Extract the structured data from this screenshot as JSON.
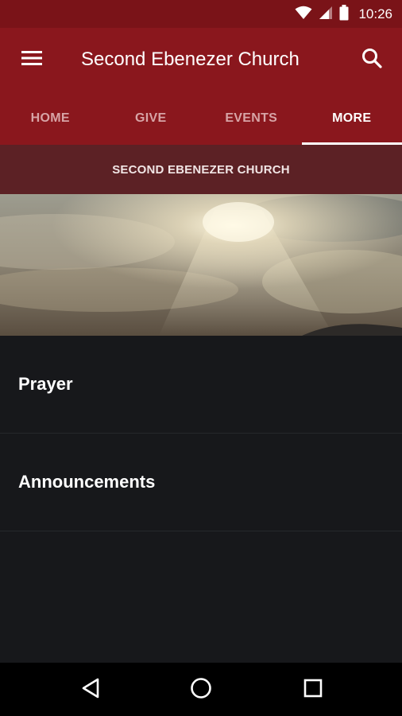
{
  "status_bar": {
    "time": "10:26",
    "icons": [
      "wifi-icon",
      "signal-icon",
      "battery-icon"
    ]
  },
  "app_bar": {
    "title": "Second Ebenezer Church",
    "menu_icon": "hamburger-menu-icon",
    "search_icon": "search-icon"
  },
  "tabs": [
    {
      "label": "HOME",
      "active": false
    },
    {
      "label": "GIVE",
      "active": false
    },
    {
      "label": "EVENTS",
      "active": false
    },
    {
      "label": "MORE",
      "active": true
    }
  ],
  "banner": {
    "title": "SECOND EBENEZER CHURCH"
  },
  "hero_image": {
    "subject": "sunlight through clouds"
  },
  "menu_items": [
    {
      "label": "Prayer"
    },
    {
      "label": "Announcements"
    }
  ],
  "nav_bar": {
    "icons": [
      "back-icon",
      "home-icon",
      "recents-icon"
    ]
  },
  "colors": {
    "primary": "#8a171d",
    "status_bar": "#7a1318",
    "banner": "#5c2125",
    "background": "#17181b"
  }
}
